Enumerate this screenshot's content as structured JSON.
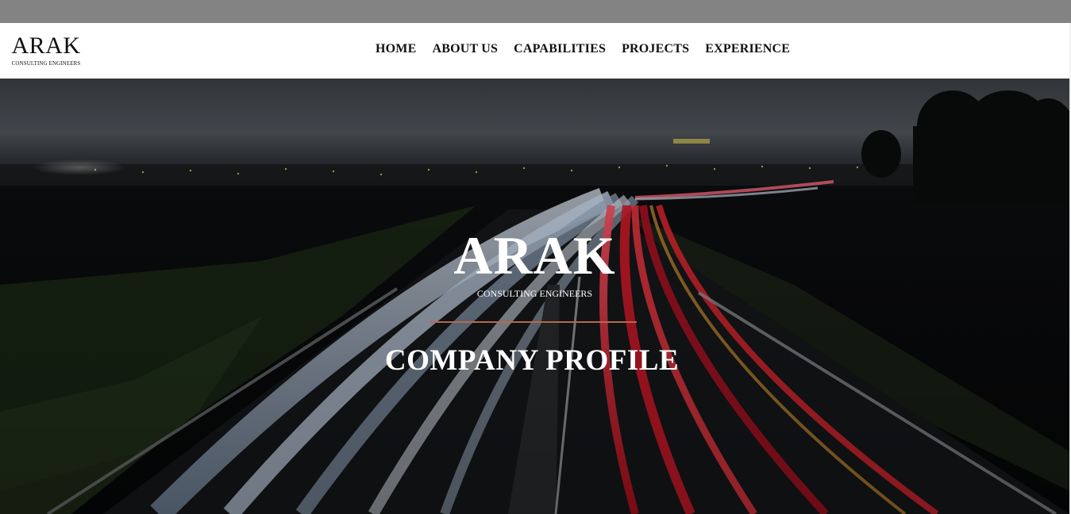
{
  "header": {
    "logo_title": "ARAK",
    "logo_subtitle": "CONSULTING ENGINEERS"
  },
  "nav": {
    "items": [
      {
        "label": "HOME"
      },
      {
        "label": "ABOUT US"
      },
      {
        "label": "CAPABILITIES"
      },
      {
        "label": "PROJECTS"
      },
      {
        "label": "EXPERIENCE"
      }
    ]
  },
  "hero": {
    "title": "ARAK",
    "subtitle": "CONSULTING ENGINEERS",
    "heading": "COMPANY PROFILE",
    "background_image": "night-highway-light-trails"
  },
  "colors": {
    "top_strip": "#838383",
    "navbar_bg": "#ffffff",
    "nav_text": "#111111",
    "hero_text": "#ffffff",
    "divider": "#b8674f"
  }
}
